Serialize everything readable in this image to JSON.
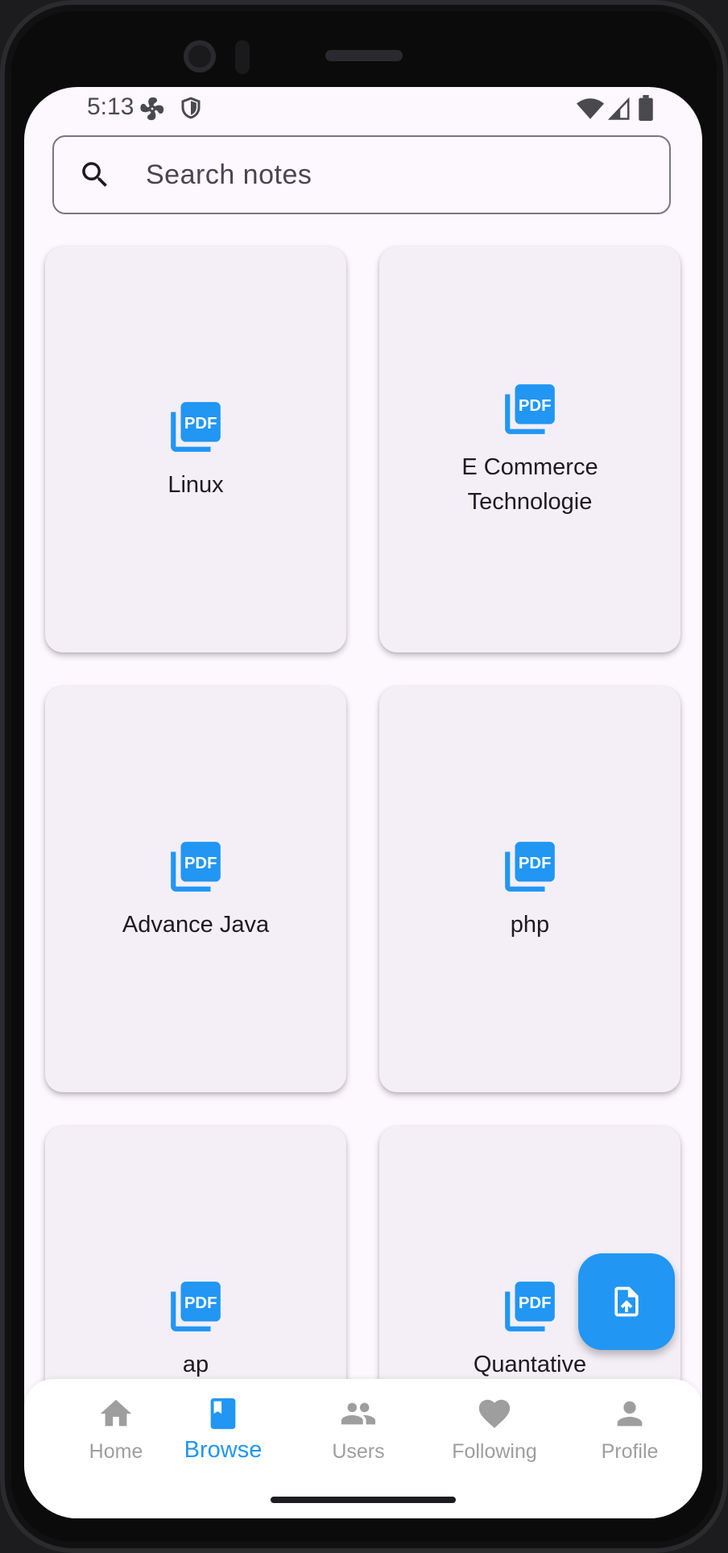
{
  "status_bar": {
    "time": "5:13"
  },
  "search": {
    "placeholder": "Search notes"
  },
  "notes": [
    {
      "title": "Linux"
    },
    {
      "title": "E Commerce Technologie"
    },
    {
      "title": "Advance Java"
    },
    {
      "title": "php"
    },
    {
      "title": "ap"
    },
    {
      "title": "Quantative"
    }
  ],
  "icons": {
    "note": "pdf-icon",
    "fab": "upload-file-icon"
  },
  "colors": {
    "accent": "#2196f3",
    "inactive": "#9e9e9e",
    "card": "#f4eff6",
    "background": "#fdf7fe"
  },
  "nav": {
    "items": [
      {
        "label": "Home",
        "icon": "home-icon"
      },
      {
        "label": "Browse",
        "icon": "book-icon",
        "active": true
      },
      {
        "label": "Users",
        "icon": "users-icon"
      },
      {
        "label": "Following",
        "icon": "heart-icon"
      },
      {
        "label": "Profile",
        "icon": "person-icon"
      }
    ]
  }
}
